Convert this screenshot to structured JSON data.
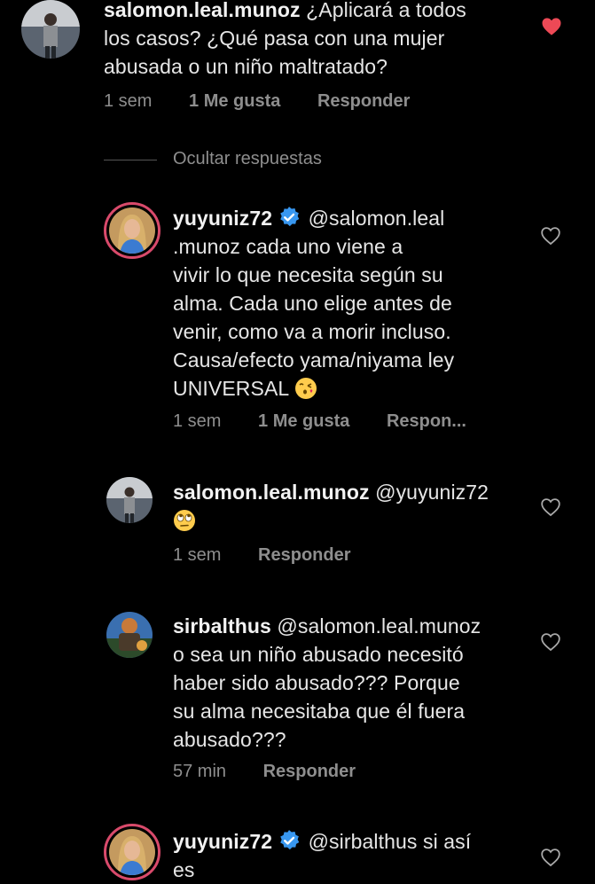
{
  "comments": [
    {
      "username": "salomon.leal.munoz",
      "text_lines": [
        "¿Aplicará a todos",
        "los casos? ¿Qué pasa con una mujer",
        "abusada o un niño maltratado?"
      ],
      "time": "1 sem",
      "likes": "1 Me gusta",
      "reply": "Responder",
      "liked": true
    },
    {
      "username": "yuyuniz72",
      "verified": true,
      "text_lines": [
        "@salomon.leal",
        ".munoz cada uno viene a",
        "vivir lo que necesita según su",
        "alma. Cada uno elige antes de",
        "venir, como va a morir incluso.",
        "Causa/efecto yama/niyama ley",
        "UNIVERSAL"
      ],
      "emoji": "kissing-heart-emoji",
      "time": "1 sem",
      "likes": "1 Me gusta",
      "reply": "Respon...",
      "liked": false
    },
    {
      "username": "salomon.leal.munoz",
      "text_lines": [
        "@yuyuniz72"
      ],
      "emoji": "eye-roll-emoji",
      "time": "1 sem",
      "reply": "Responder",
      "liked": false
    },
    {
      "username": "sirbalthus",
      "text_lines": [
        "@salomon.leal.munoz",
        "o sea un niño abusado necesitó",
        "haber sido abusado??? Porque",
        "su alma necesitaba que él fuera",
        "abusado???"
      ],
      "time": "57 min",
      "reply": "Responder",
      "liked": false
    },
    {
      "username": "yuyuniz72",
      "verified": true,
      "text_lines": [
        "@sirbalthus si así",
        "es"
      ],
      "liked": false
    }
  ],
  "hide_replies": "Ocultar respuestas",
  "colors": {
    "background": "#000000",
    "liked_heart": "#ed4956",
    "verified_badge": "#3897f0",
    "meta_text": "#8e8e8e"
  }
}
